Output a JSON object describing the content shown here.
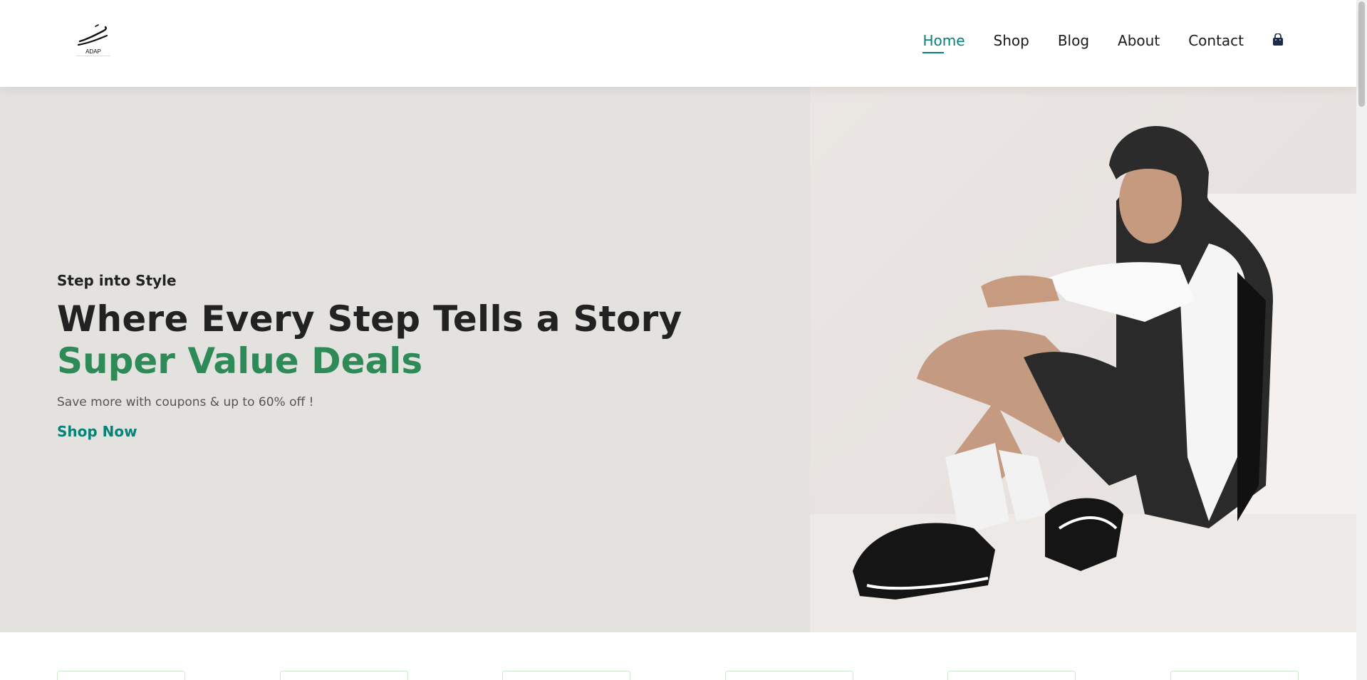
{
  "brand": {
    "logo_text": "ADAP"
  },
  "nav": {
    "items": [
      {
        "label": "Home",
        "active": true
      },
      {
        "label": "Shop",
        "active": false
      },
      {
        "label": "Blog",
        "active": false
      },
      {
        "label": "About",
        "active": false
      },
      {
        "label": "Contact",
        "active": false
      }
    ],
    "cart_icon": "shopping-bag-icon"
  },
  "hero": {
    "kicker": "Step into Style",
    "headline": "Where Every Step Tells a Story",
    "headline_accent": "Super Value Deals",
    "subtext": "Save more with coupons & up to 60% off !",
    "cta_label": "Shop Now",
    "image_alt": "model in black hoodie and black running sneakers sitting"
  },
  "colors": {
    "accent_teal": "#088178",
    "accent_green": "#2e8b57",
    "hero_bg": "#e4e2df",
    "text_dark": "#222222"
  }
}
